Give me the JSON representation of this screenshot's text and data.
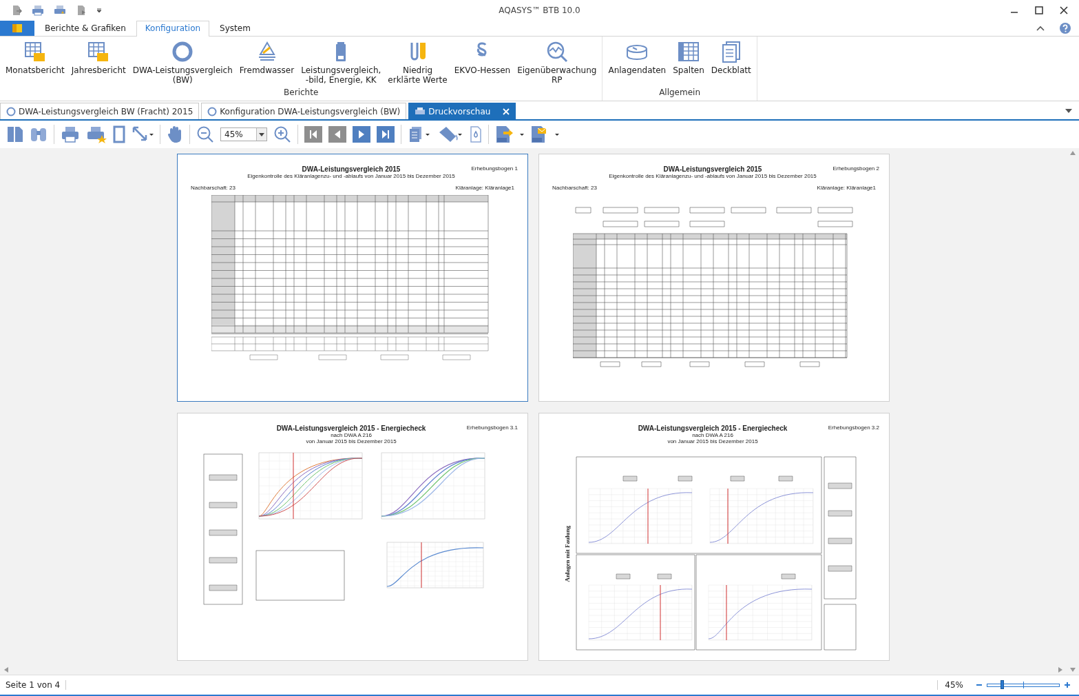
{
  "window": {
    "title": "AQASYS™ BTB 10.0"
  },
  "ribbon": {
    "tabs": [
      {
        "label": "Berichte & Grafiken",
        "selected": false
      },
      {
        "label": "Konfiguration",
        "selected": true
      },
      {
        "label": "System",
        "selected": false
      }
    ],
    "groups": [
      {
        "label": "Berichte",
        "items": [
          {
            "label": "Monatsbericht"
          },
          {
            "label": "Jahresbericht"
          },
          {
            "label": "DWA-Leistungsvergleich\n(BW)"
          },
          {
            "label": "Fremdwasser"
          },
          {
            "label": "Leistungsvergleich,\n-bild, Energie, KK"
          },
          {
            "label": "Niedrig\nerklärte Werte"
          },
          {
            "label": "EKVO-Hessen"
          },
          {
            "label": "Eigenüberwachung\nRP"
          }
        ]
      },
      {
        "label": "Allgemein",
        "items": [
          {
            "label": "Anlagendaten"
          },
          {
            "label": "Spalten"
          },
          {
            "label": "Deckblatt"
          }
        ]
      }
    ]
  },
  "doc_tabs": [
    {
      "label": "DWA-Leistungsvergleich BW (Fracht) 2015",
      "selected": false,
      "closable": false
    },
    {
      "label": "Konfiguration DWA-Leistungsvergleich (BW)",
      "selected": false,
      "closable": false
    },
    {
      "label": "Druckvorschau",
      "selected": true,
      "closable": true
    }
  ],
  "toolbar": {
    "zoom": "45%",
    "nav": [
      {
        "disabled": true
      },
      {
        "disabled": true
      },
      {
        "disabled": false
      },
      {
        "disabled": false
      }
    ]
  },
  "pages": [
    {
      "kind": "table",
      "selected": true,
      "title": "DWA-Leistungsvergleich 2015",
      "subtitle": "Eigenkontrolle des Kläranlagenzu- und -ablaufs von Januar 2015 bis Dezember 2015",
      "sheet": "Erhebungsbogen 1",
      "left_label": "Nachbarschaft: 23",
      "right_label": "Kläranlage: Kläranlage1"
    },
    {
      "kind": "form",
      "selected": false,
      "title": "DWA-Leistungsvergleich 2015",
      "subtitle": "Eigenkontrolle des Kläranlagenzu- und -ablaufs von Januar 2015 bis Dezember 2015",
      "sheet": "Erhebungsbogen 2",
      "left_label": "Nachbarschaft: 23",
      "right_label": "Kläranlage: Kläranlage1"
    },
    {
      "kind": "charts",
      "selected": false,
      "title": "DWA-Leistungsvergleich 2015 - Energiecheck",
      "subtitle": "nach DWA A 216",
      "period": "von Januar 2015 bis Dezember 2015",
      "sheet": "Erhebungsbogen 3.1"
    },
    {
      "kind": "grid",
      "selected": false,
      "title": "DWA-Leistungsvergleich 2015 - Energiecheck",
      "subtitle": "nach DWA A 216",
      "period": "von Januar 2015 bis Dezember 2015",
      "sheet": "Erhebungsbogen 3.2",
      "side_label": "Anlagen mit Faulung"
    }
  ],
  "status_bar": {
    "page": "Seite 1 von 4",
    "zoom": "45%",
    "level": 0.2
  }
}
